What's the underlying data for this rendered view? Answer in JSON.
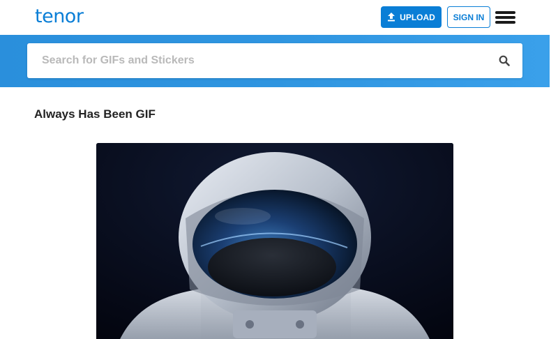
{
  "header": {
    "logo_text": "tenor",
    "upload_label": "UPLOAD",
    "signin_label": "SIGN IN",
    "menu_icon": "hamburger-menu-icon",
    "upload_icon": "upload-arrow-icon"
  },
  "search": {
    "placeholder": "Search for GIFs and Stickers",
    "value": "",
    "button_icon": "search-icon"
  },
  "main": {
    "title": "Always Has Been GIF"
  },
  "colors": {
    "brand": "#0a7ed6",
    "search_band": "#2f95e0",
    "gif_background": "#05091c"
  }
}
